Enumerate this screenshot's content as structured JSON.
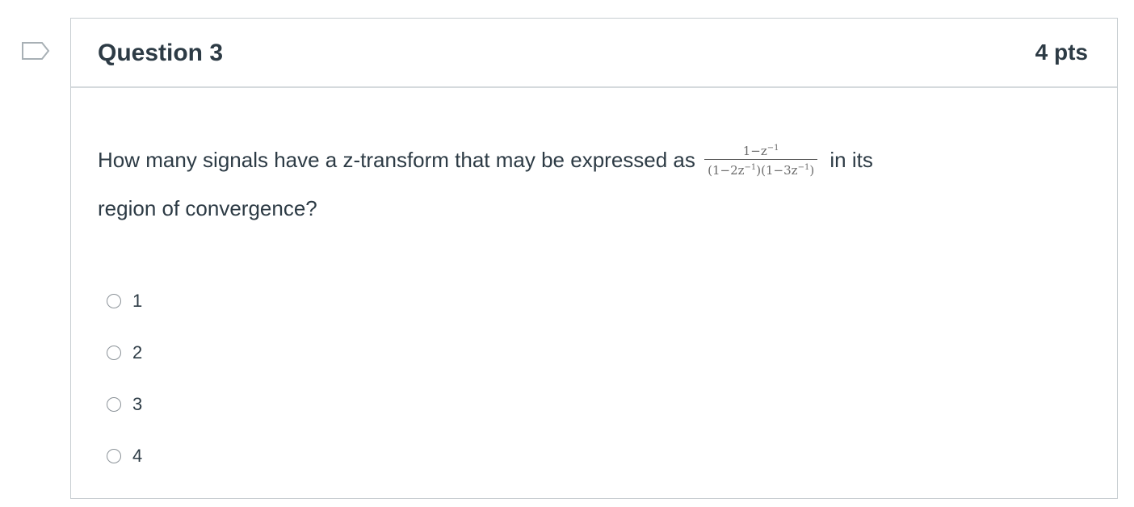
{
  "question": {
    "title": "Question 3",
    "points": "4 pts",
    "text_before": "How many signals have a z-transform that may be expressed as",
    "fraction": {
      "numerator": "1−z",
      "numerator_exp": "−1",
      "denominator_part1": "(1−2z",
      "denominator_exp1": "−1",
      "denominator_part2": ")(1−3z",
      "denominator_exp2": "−1",
      "denominator_part3": ")"
    },
    "text_after": "in its",
    "text_line2": "region of convergence?"
  },
  "answers": [
    {
      "label": "1"
    },
    {
      "label": "2"
    },
    {
      "label": "3"
    },
    {
      "label": "4"
    }
  ],
  "icons": {
    "flag": "flag-icon",
    "radio": "radio-icon"
  }
}
